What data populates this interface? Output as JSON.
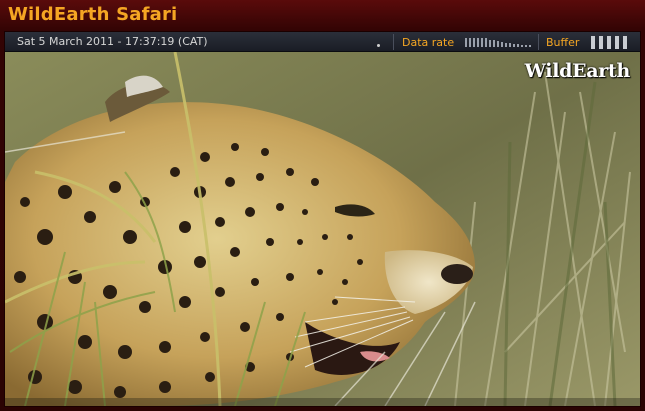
{
  "app": {
    "title": "WildEarth Safari"
  },
  "status_bar": {
    "datetime": "Sat 5 March 2011 - 17:37:19 (CAT)",
    "data_rate_label": "Data rate",
    "buffer_label": "Buffer"
  },
  "video": {
    "watermark": "WildEarth",
    "subject": "leopard-in-grass"
  },
  "colors": {
    "accent": "#f5a623",
    "frame": "#3a0707",
    "bar": "#23262f"
  }
}
